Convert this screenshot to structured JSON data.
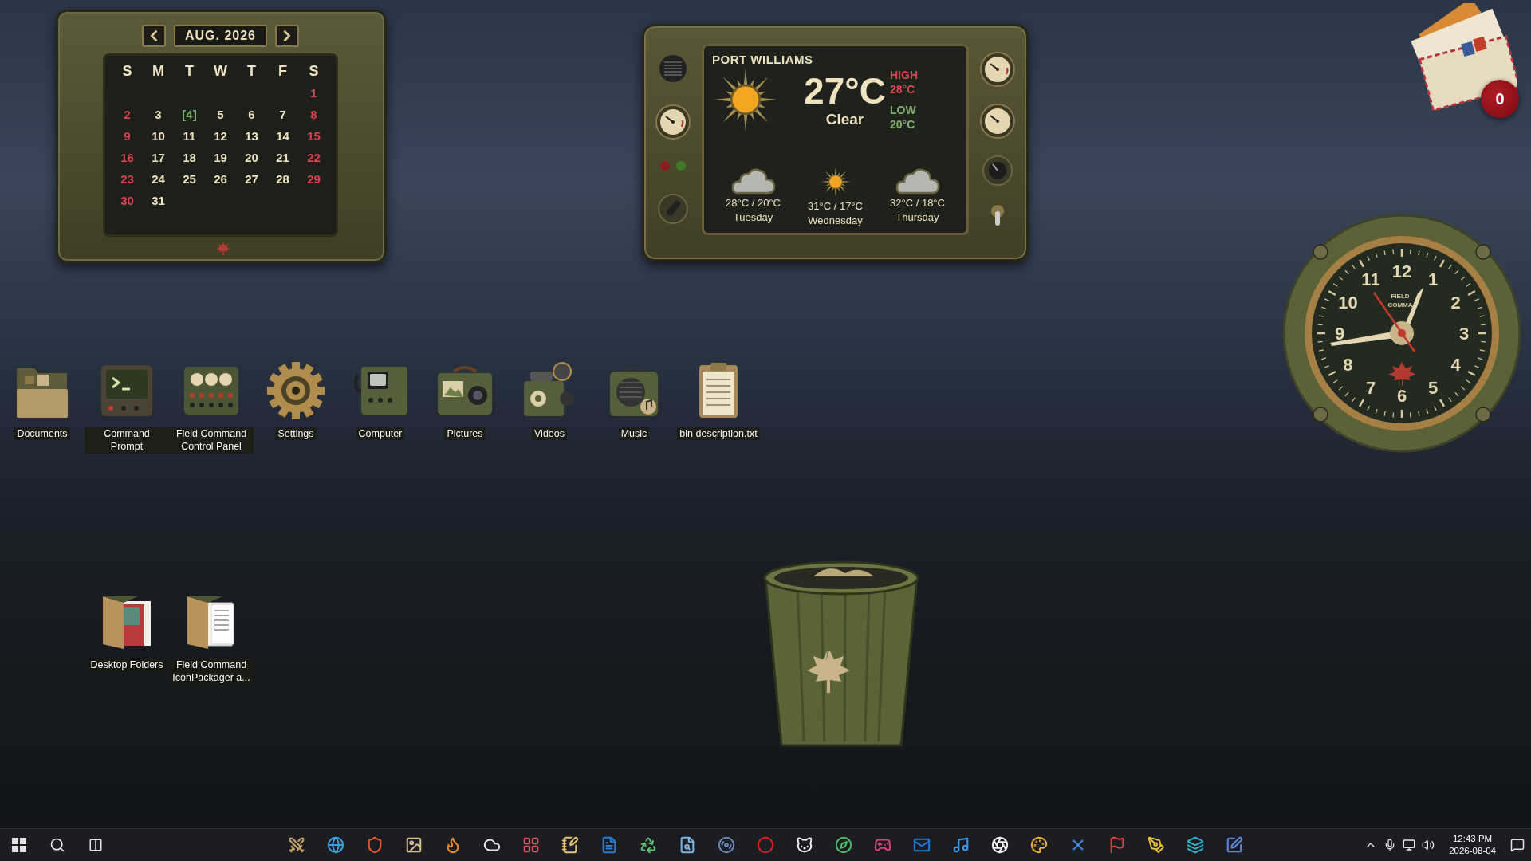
{
  "calendar": {
    "month": "AUG. 2026",
    "weekdays": [
      "S",
      "M",
      "T",
      "W",
      "T",
      "F",
      "S"
    ],
    "weeks": [
      {
        "days": [
          {
            "text": "1",
            "kind": "weekend"
          }
        ]
      },
      {
        "days": [
          {
            "text": "2",
            "kind": "weekend"
          },
          {
            "text": "3",
            "kind": "weekday"
          },
          {
            "text": "[4]",
            "kind": "today"
          },
          {
            "text": "5",
            "kind": "weekday"
          },
          {
            "text": "6",
            "kind": "weekday"
          },
          {
            "text": "7",
            "kind": "weekday"
          },
          {
            "text": "8",
            "kind": "weekend"
          }
        ]
      },
      {
        "days": [
          {
            "text": "9",
            "kind": "weekend"
          },
          {
            "text": "10",
            "kind": "weekday"
          },
          {
            "text": "11",
            "kind": "weekday"
          },
          {
            "text": "12",
            "kind": "weekday"
          },
          {
            "text": "13",
            "kind": "weekday"
          },
          {
            "text": "14",
            "kind": "weekday"
          },
          {
            "text": "15",
            "kind": "weekend"
          }
        ]
      },
      {
        "days": [
          {
            "text": "16",
            "kind": "weekend"
          },
          {
            "text": "17",
            "kind": "weekday"
          },
          {
            "text": "18",
            "kind": "weekday"
          },
          {
            "text": "19",
            "kind": "weekday"
          },
          {
            "text": "20",
            "kind": "weekday"
          },
          {
            "text": "21",
            "kind": "weekday"
          },
          {
            "text": "22",
            "kind": "weekend"
          }
        ]
      },
      {
        "days": [
          {
            "text": "23",
            "kind": "weekend"
          },
          {
            "text": "24",
            "kind": "weekday"
          },
          {
            "text": "25",
            "kind": "weekday"
          },
          {
            "text": "26",
            "kind": "weekday"
          },
          {
            "text": "27",
            "kind": "weekday"
          },
          {
            "text": "28",
            "kind": "weekday"
          },
          {
            "text": "29",
            "kind": "weekend"
          }
        ]
      },
      {
        "days": [
          {
            "text": "30",
            "kind": "weekend"
          },
          {
            "text": "31",
            "kind": "weekday"
          }
        ]
      }
    ]
  },
  "weather": {
    "location": "PORT WILLIAMS",
    "temperature": "27°C",
    "condition": "Clear",
    "high_label": "HIGH",
    "high": "28°C",
    "low_label": "LOW",
    "low": "20°C",
    "forecast": [
      {
        "range": "28°C / 20°C",
        "day": "Tuesday",
        "kind": "cloudy"
      },
      {
        "range": "31°C / 17°C",
        "day": "Wednesday",
        "kind": "sunny"
      },
      {
        "range": "32°C / 18°C",
        "day": "Thursday",
        "kind": "cloudy"
      }
    ]
  },
  "mail": {
    "count": "0"
  },
  "clock": {
    "numerals": [
      "12",
      "11",
      "1",
      "10",
      "2",
      "9",
      "3",
      "8",
      "4",
      "7",
      "5",
      "6"
    ],
    "brand": [
      "FIELD",
      "COMMA"
    ]
  },
  "desktop": {
    "icons": [
      {
        "label": "Documents",
        "kind": "folder"
      },
      {
        "label": "Command Prompt",
        "kind": "terminal"
      },
      {
        "label": "Field Command Control Panel",
        "kind": "panel"
      },
      {
        "label": "Settings",
        "kind": "gear"
      },
      {
        "label": "Computer",
        "kind": "computer"
      },
      {
        "label": "Pictures",
        "kind": "camera"
      },
      {
        "label": "Videos",
        "kind": "projector"
      },
      {
        "label": "Music",
        "kind": "speaker"
      },
      {
        "label": "bin description.txt",
        "kind": "clipboard"
      }
    ],
    "folders": [
      {
        "label": "Desktop Folders",
        "kind": "photo-folder"
      },
      {
        "label": "Field Command IconPackager a...",
        "kind": "book-folder"
      }
    ]
  },
  "taskbar": {
    "time": "12:43 PM",
    "date": "2026-08-04"
  }
}
